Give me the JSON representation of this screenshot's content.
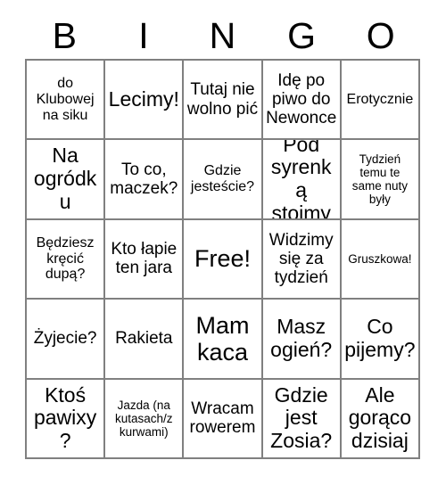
{
  "header": {
    "letters": [
      "B",
      "I",
      "N",
      "G",
      "O"
    ]
  },
  "grid": {
    "rows": [
      {
        "cells": [
          {
            "text": "do Klubowej na siku",
            "size": "md"
          },
          {
            "text": "Lecimy!",
            "size": "xl"
          },
          {
            "text": "Tutaj nie wolno pić",
            "size": "lg"
          },
          {
            "text": "Idę po piwo do Newonce",
            "size": "lg"
          },
          {
            "text": "Erotycznie",
            "size": "md"
          }
        ]
      },
      {
        "cells": [
          {
            "text": "Na ogródku",
            "size": "xl"
          },
          {
            "text": "To co, maczek?",
            "size": "lg"
          },
          {
            "text": "Gdzie jesteście?",
            "size": "md"
          },
          {
            "text": "Pod syrenką stoimy",
            "size": "xl"
          },
          {
            "text": "Tydzień temu te same nuty były",
            "size": "sm"
          }
        ]
      },
      {
        "cells": [
          {
            "text": "Będziesz kręcić dupą?",
            "size": "md"
          },
          {
            "text": "Kto łapie ten jara",
            "size": "lg"
          },
          {
            "text": "Free!",
            "size": "xxl"
          },
          {
            "text": "Widzimy się za tydzień",
            "size": "lg"
          },
          {
            "text": "Gruszkowa!",
            "size": "sm"
          }
        ]
      },
      {
        "cells": [
          {
            "text": "Żyjecie?",
            "size": "lg"
          },
          {
            "text": "Rakieta",
            "size": "lg"
          },
          {
            "text": "Mam kaca",
            "size": "xxl"
          },
          {
            "text": "Masz ogień?",
            "size": "xl"
          },
          {
            "text": "Co pijemy?",
            "size": "xl"
          }
        ]
      },
      {
        "cells": [
          {
            "text": "Ktoś pawixy?",
            "size": "xl"
          },
          {
            "text": "Jazda (na kutasach/z kurwami)",
            "size": "sm"
          },
          {
            "text": "Wracam rowerem",
            "size": "lg"
          },
          {
            "text": "Gdzie jest Zosia?",
            "size": "xl"
          },
          {
            "text": "Ale gorąco dzisiaj",
            "size": "xl"
          }
        ]
      }
    ]
  },
  "colors": {
    "background": "#ffffff",
    "text": "#000000",
    "grid_line": "#808080"
  }
}
